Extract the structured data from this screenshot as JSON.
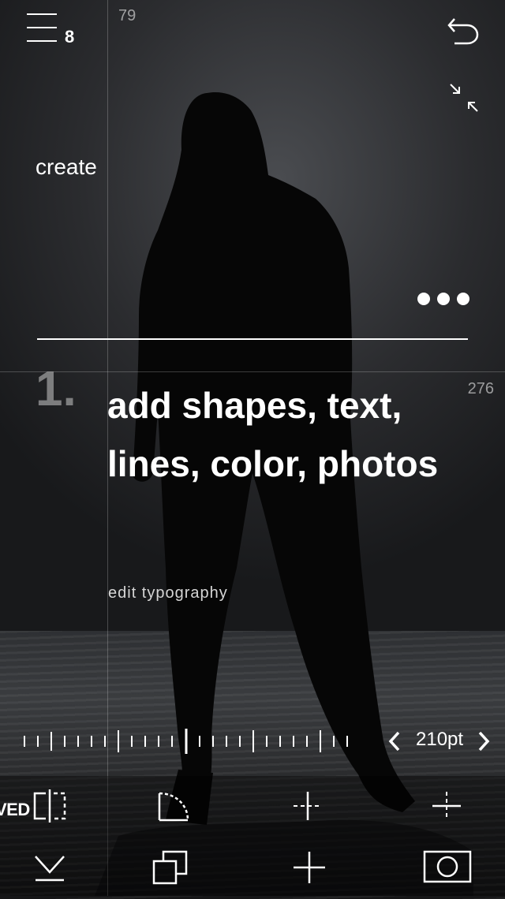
{
  "header": {
    "menu_icon": "hamburger-menu-icon",
    "layer_count": "8",
    "top_coordinate": "79",
    "undo_icon": "undo-arrow-icon",
    "resize_icon": "shrink-arrows-icon"
  },
  "canvas": {
    "create_label": "create",
    "more_icon": "more-dots-icon",
    "step_number": "1.",
    "headline": "add shapes, text, lines, color, photos",
    "sub_link": "edit typography",
    "right_coordinate": "276"
  },
  "size_control": {
    "value": "210pt",
    "prev_icon": "chevron-left-icon",
    "next_icon": "chevron-right-icon"
  },
  "toolbar": {
    "saved_label": "VED",
    "row1": [
      "flip-horizontal-icon",
      "corner-radius-icon",
      "center-vertical-guide-icon",
      "center-horizontal-guide-icon"
    ],
    "row2": [
      "collapse-chevron-icon",
      "duplicate-layers-icon",
      "add-plus-icon",
      "camera-icon"
    ]
  },
  "colors": {
    "accent": "#ffffff",
    "guide": "#ffffff38",
    "step_number": "#ffffff6b",
    "background": "#1b1c1e"
  }
}
